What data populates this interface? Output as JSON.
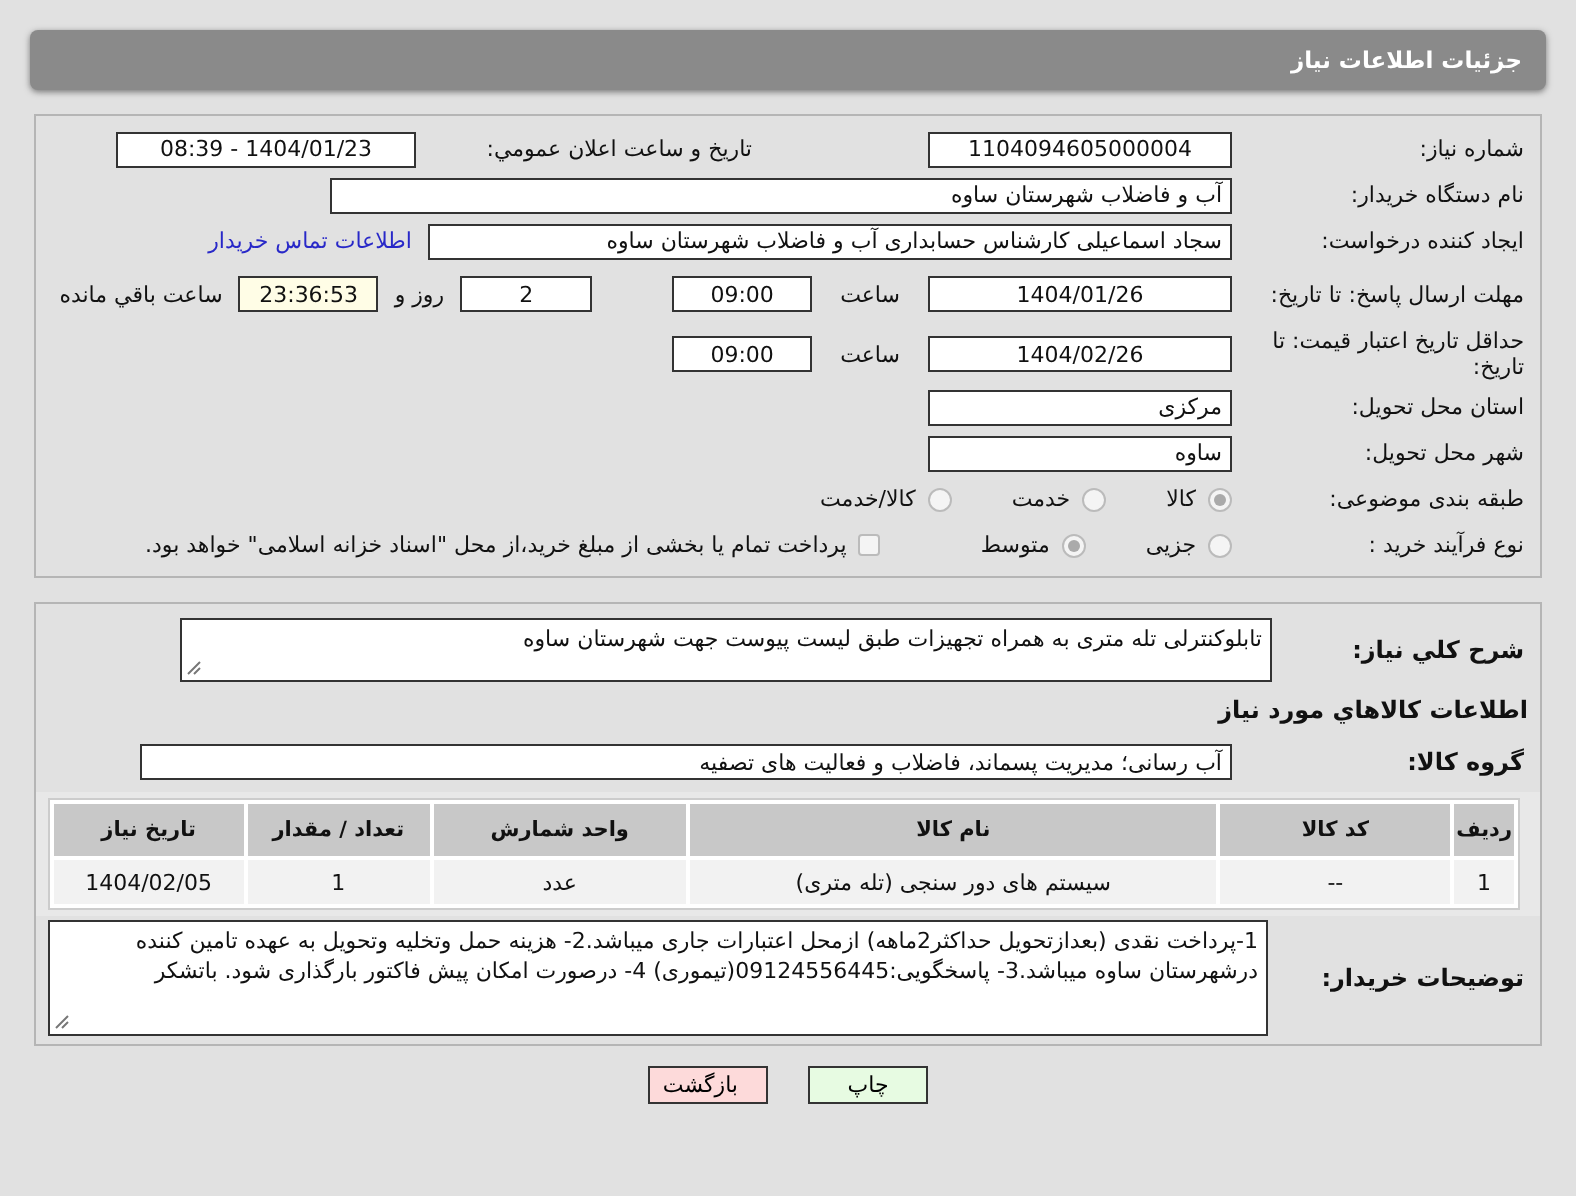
{
  "header": {
    "title": "جزئیات اطلاعات نیاز"
  },
  "need_number": {
    "label": "شماره نیاز:",
    "value": "1104094605000004"
  },
  "announce": {
    "label": "تاریخ و ساعت اعلان عمومي:",
    "value": "1404/01/23 - 08:39"
  },
  "buyer_org": {
    "label": "نام دستگاه خریدار:",
    "value": "آب و فاضلاب شهرستان ساوه"
  },
  "requester": {
    "label": "ایجاد کننده درخواست:",
    "value": "سجاد اسماعیلی کارشناس حسابداری آب و فاضلاب شهرستان ساوه",
    "contact_link": "اطلاعات تماس خریدار"
  },
  "deadline": {
    "label": "مهلت ارسال پاسخ: تا تاریخ:",
    "date": "1404/01/26",
    "time_label": "ساعت",
    "time": "09:00",
    "days": "2",
    "days_label": "روز و",
    "remaining": "23:36:53",
    "remaining_label": "ساعت باقي مانده"
  },
  "validity": {
    "label": "حداقل تاریخ اعتبار قیمت: تا تاریخ:",
    "date": "1404/02/26",
    "time_label": "ساعت",
    "time": "09:00"
  },
  "province": {
    "label": "استان محل تحویل:",
    "value": "مرکزی"
  },
  "city": {
    "label": "شهر محل تحویل:",
    "value": "ساوه"
  },
  "category": {
    "label": "طبقه بندی موضوعی:",
    "options": [
      {
        "label": "کالا",
        "selected": true
      },
      {
        "label": "خدمت",
        "selected": false
      },
      {
        "label": "کالا/خدمت",
        "selected": false
      }
    ]
  },
  "process": {
    "label": "نوع فرآیند خرید :",
    "options": [
      {
        "label": "جزیی",
        "selected": false
      },
      {
        "label": "متوسط",
        "selected": true
      }
    ],
    "payment": {
      "checked": false,
      "text": "پرداخت تمام یا بخشی از مبلغ خرید،از محل \"اسناد خزانه اسلامی\" خواهد بود."
    }
  },
  "description": {
    "label": "شرح كلي نياز:",
    "value": "تابلوکنترلی تله متری به همراه تجهیزات طبق لیست پیوست جهت شهرستان ساوه"
  },
  "goods_heading": "اطلاعات كالاهاي مورد نياز",
  "goods_group": {
    "label": "گروه کالا:",
    "value": "آب رسانی؛ مدیریت پسماند، فاضلاب و فعالیت های تصفیه"
  },
  "table": {
    "columns": [
      "ردیف",
      "کد کالا",
      "نام کالا",
      "واحد شمارش",
      "تعداد / مقدار",
      "تاریخ نیاز"
    ],
    "rows": [
      [
        "1",
        "--",
        "سیستم های دور سنجی (تله متری)",
        "عدد",
        "1",
        "1404/02/05"
      ]
    ]
  },
  "buyer_notes": {
    "label": "توضیحات خریدار:",
    "value": "1-پرداخت  نقدی (بعدازتحویل حداکثر2ماهه) ازمحل اعتبارات جاری میباشد.2- هزینه حمل وتخلیه وتحویل به عهده تامین کننده درشهرستان ساوه میباشد.3- پاسخگویی:09124556445(تیموری) 4- درصورت امکان پیش فاکتور بارگذاری شود. باتشکر"
  },
  "buttons": [
    {
      "label": "چاپ",
      "kind": "print"
    },
    {
      "label": "بازگشت",
      "kind": "back"
    }
  ]
}
